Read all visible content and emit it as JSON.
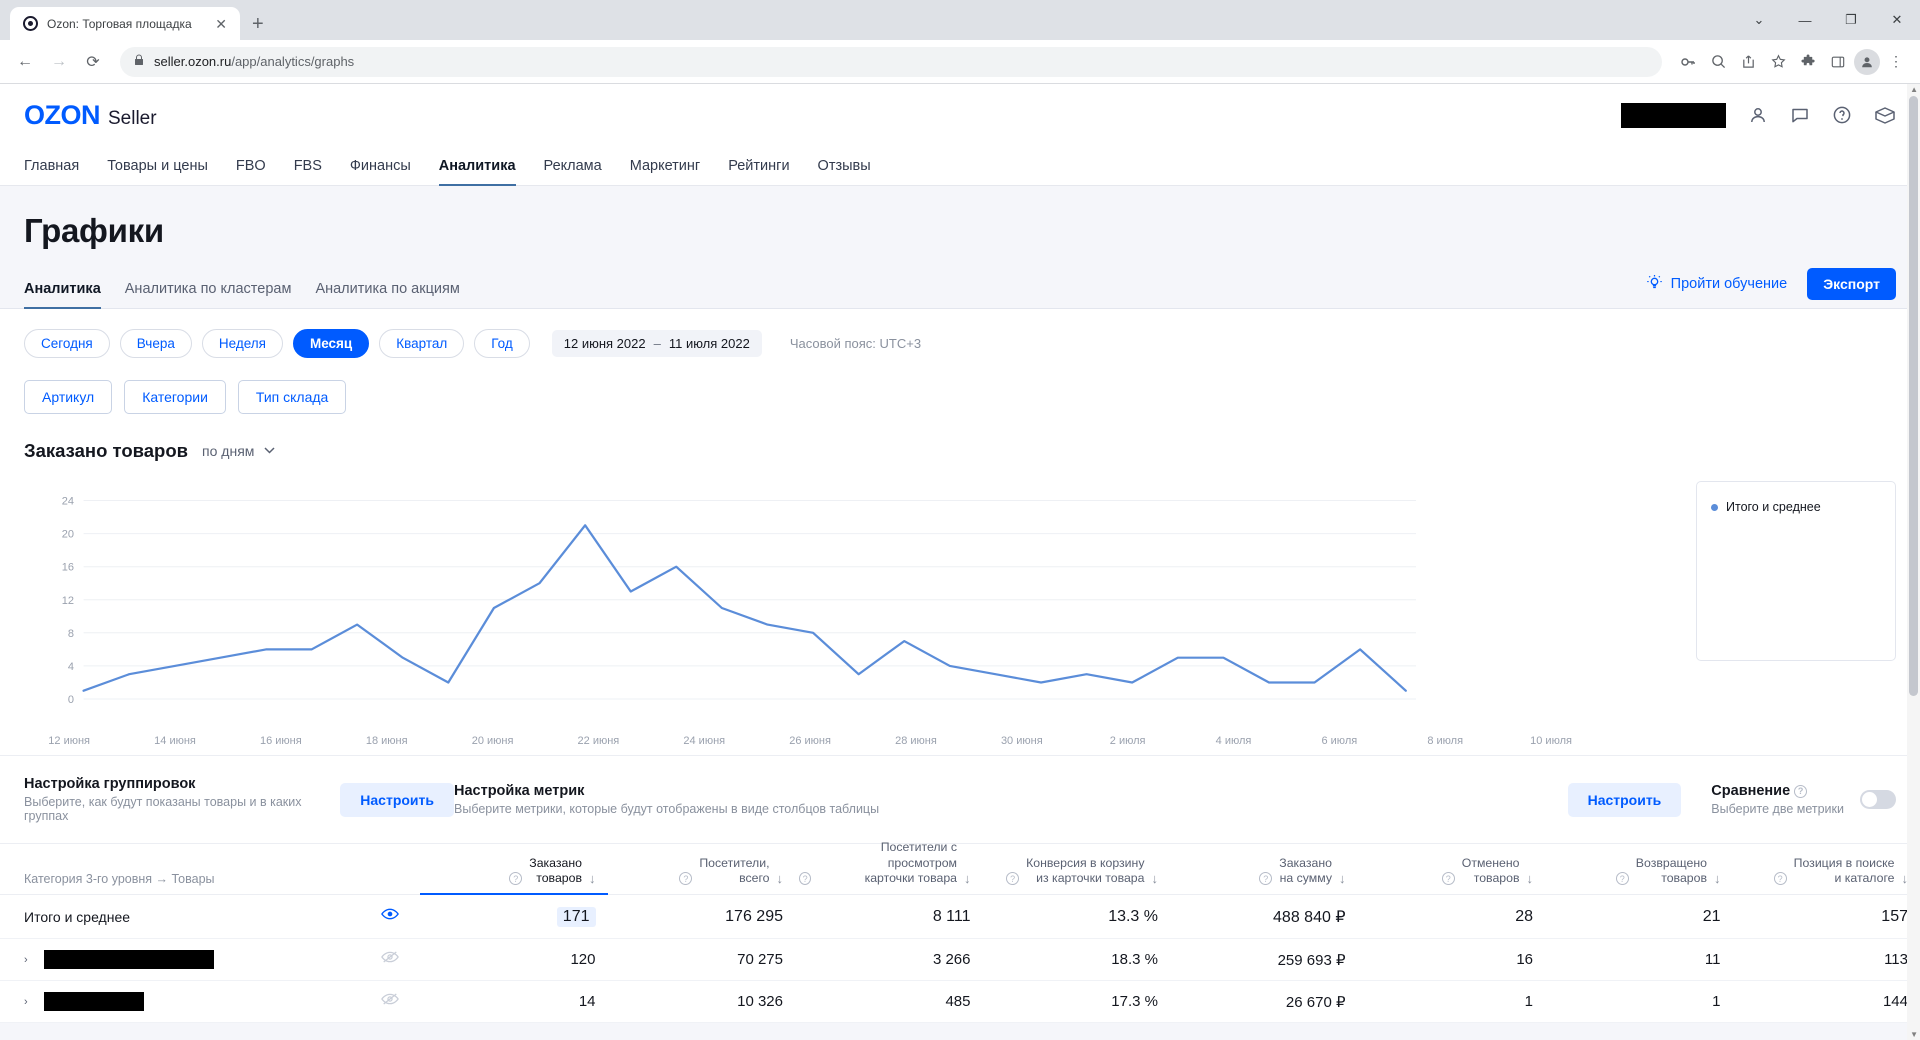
{
  "browser": {
    "tab_title": "Ozon: Торговая площадка",
    "tab_favicon": "ozon-favicon",
    "close_glyph": "✕",
    "newtab_glyph": "+",
    "back_glyph": "←",
    "forward_glyph": "→",
    "reload_glyph": "⟳",
    "lock_glyph": "🔒",
    "url_domain": "seller.ozon.ru",
    "url_path": "/app/analytics/graphs",
    "win_minimize": "—",
    "win_maximize": "❐",
    "win_close": "✕",
    "win_chevron": "⌄",
    "icons": {
      "key": "⚷",
      "zoom_out": "🔍",
      "share": "↗",
      "bookmark": "☆",
      "extensions": "🧩",
      "sidepanel": "▢",
      "profile": "👤",
      "menu": "⋮"
    }
  },
  "header": {
    "logo_main": "OZON",
    "logo_sub": "Seller",
    "account_redacted": true,
    "icons": {
      "user": "account-icon",
      "chat": "chat-icon",
      "help": "help-icon",
      "box": "box-icon"
    }
  },
  "nav": {
    "items": [
      {
        "label": "Главная",
        "active": false
      },
      {
        "label": "Товары и цены",
        "active": false
      },
      {
        "label": "FBO",
        "active": false
      },
      {
        "label": "FBS",
        "active": false
      },
      {
        "label": "Финансы",
        "active": false
      },
      {
        "label": "Аналитика",
        "active": true
      },
      {
        "label": "Реклама",
        "active": false
      },
      {
        "label": "Маркетинг",
        "active": false
      },
      {
        "label": "Рейтинги",
        "active": false
      },
      {
        "label": "Отзывы",
        "active": false
      }
    ]
  },
  "page": {
    "title": "Графики",
    "subtabs": [
      {
        "label": "Аналитика",
        "active": true
      },
      {
        "label": "Аналитика по кластерам",
        "active": false
      },
      {
        "label": "Аналитика по акциям",
        "active": false
      }
    ],
    "learn_label": "Пройти обучение",
    "export_label": "Экспорт"
  },
  "period": {
    "chips": [
      {
        "label": "Сегодня",
        "active": false
      },
      {
        "label": "Вчера",
        "active": false
      },
      {
        "label": "Неделя",
        "active": false
      },
      {
        "label": "Месяц",
        "active": true
      },
      {
        "label": "Квартал",
        "active": false
      },
      {
        "label": "Год",
        "active": false
      }
    ],
    "date_from": "12 июня 2022",
    "date_sep": "–",
    "date_to": "11 июля 2022",
    "timezone": "Часовой пояс: UTC+3"
  },
  "filters": [
    {
      "label": "Артикул"
    },
    {
      "label": "Категории"
    },
    {
      "label": "Тип склада"
    }
  ],
  "chart_header": {
    "title": "Заказано товаров",
    "grouping": "по дням",
    "caret": "⌄"
  },
  "chart_data": {
    "type": "line",
    "title": "Заказано товаров",
    "xlabel": "",
    "ylabel": "",
    "ylim": [
      0,
      26
    ],
    "yticks": [
      0,
      4,
      8,
      12,
      16,
      20,
      24
    ],
    "grid": true,
    "legend_position": "right",
    "legend": [
      "Итого и среднее"
    ],
    "series_color": "#5b8dd9",
    "xticks": [
      "12 июня",
      "14 июня",
      "16 июня",
      "18 июня",
      "20 июня",
      "22 июня",
      "24 июня",
      "26 июня",
      "28 июня",
      "30 июня",
      "2 июля",
      "4 июля",
      "6 июля",
      "8 июля",
      "10 июля"
    ],
    "x": [
      "12 июня",
      "13 июня",
      "14 июня",
      "15 июня",
      "16 июня",
      "17 июня",
      "18 июня",
      "19 июня",
      "20 июня",
      "21 июня",
      "22 июня",
      "23 июня",
      "24 июня",
      "25 июня",
      "26 июня",
      "27 июня",
      "28 июня",
      "29 июня",
      "30 июня",
      "1 июля",
      "2 июля",
      "3 июля",
      "4 июля",
      "5 июля",
      "6 июля",
      "7 июля",
      "8 июля",
      "9 июля",
      "10 июля",
      "11 июля"
    ],
    "series": [
      {
        "name": "Итого и среднее",
        "values": [
          1,
          3,
          4,
          5,
          6,
          6,
          9,
          5,
          2,
          11,
          14,
          21,
          13,
          16,
          11,
          9,
          8,
          3,
          7,
          4,
          3,
          2,
          3,
          2,
          5,
          5,
          2,
          2,
          6,
          1
        ]
      }
    ]
  },
  "settings": {
    "grouping_title": "Настройка группировок",
    "grouping_sub": "Выберите, как будут показаны товары и в каких группах",
    "grouping_btn": "Настроить",
    "metrics_title": "Настройка метрик",
    "metrics_sub": "Выберите метрики, которые будут отображены в виде столбцов таблицы",
    "metrics_btn": "Настроить",
    "compare_title": "Сравнение",
    "compare_sub": "Выберите две метрики",
    "compare_toggle": "off"
  },
  "table": {
    "first_col_header": "Категория 3-го уровня → Товары",
    "columns": [
      {
        "label": "Заказано\nтоваров",
        "sorted": true
      },
      {
        "label": "Посетители,\nвсего",
        "sorted": false
      },
      {
        "label": "Посетители с просмотром\nкарточки товара",
        "sorted": false
      },
      {
        "label": "Конверсия в корзину\nиз карточки товара",
        "sorted": false
      },
      {
        "label": "Заказано\nна сумму",
        "sorted": false
      },
      {
        "label": "Отменено\nтоваров",
        "sorted": false
      },
      {
        "label": "Возвращено\nтоваров",
        "sorted": false
      },
      {
        "label": "Позиция в поиске\nи каталоге",
        "sorted": false
      }
    ],
    "rows": [
      {
        "name": "Итого и среднее",
        "redacted": false,
        "expandable": false,
        "eye": "on",
        "values": [
          "171",
          "176 295",
          "8 111",
          "13.3 %",
          "488 840 ₽",
          "28",
          "21",
          "157"
        ],
        "highlight_first_value": true
      },
      {
        "name": "",
        "redacted": true,
        "redact_width": 170,
        "expandable": true,
        "eye": "off",
        "values": [
          "120",
          "70 275",
          "3 266",
          "18.3 %",
          "259 693 ₽",
          "16",
          "11",
          "113"
        ],
        "highlight_first_value": false
      },
      {
        "name": "",
        "redacted": true,
        "redact_width": 100,
        "expandable": true,
        "eye": "off",
        "values": [
          "14",
          "10 326",
          "485",
          "17.3 %",
          "26 670 ₽",
          "1",
          "1",
          "144"
        ],
        "highlight_first_value": false
      }
    ]
  },
  "colors": {
    "brand_blue": "#005bff",
    "chart_line": "#5b8dd9",
    "page_bg": "#f5f6fa"
  }
}
